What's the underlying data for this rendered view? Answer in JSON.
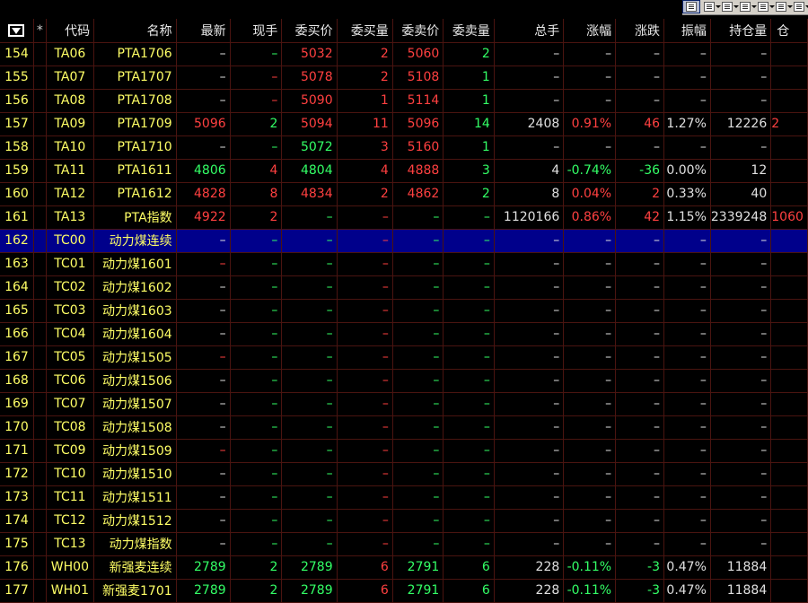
{
  "toolbar": {
    "icons": [
      "draw-tool-icon",
      "pencil-icon",
      "list-icon",
      "column-icon",
      "chart-icon",
      "grid-icon",
      "table-icon"
    ]
  },
  "headers": {
    "star": "*",
    "code": "代码",
    "name": "名称",
    "last": "最新",
    "vol_now": "现手",
    "bid": "委买价",
    "bid_vol": "委买量",
    "ask": "委卖价",
    "ask_vol": "委卖量",
    "total": "总手",
    "chg_pct": "涨幅",
    "chg": "涨跌",
    "amp": "振幅",
    "oi": "持仓量",
    "more": "仓"
  },
  "rows": [
    {
      "idx": "154",
      "code": "TA06",
      "name": "PTA1706",
      "last": "–",
      "vol_now": "–",
      "bid": "5032",
      "bid_vol": "2",
      "ask": "5060",
      "ask_vol": "2",
      "total": "–",
      "chg_pct": "–",
      "chg": "–",
      "amp": "–",
      "oi": "–",
      "more": ""
    },
    {
      "idx": "155",
      "code": "TA07",
      "name": "PTA1707",
      "last": "–",
      "vol_now": "–",
      "bid": "5078",
      "bid_vol": "2",
      "ask": "5108",
      "ask_vol": "1",
      "total": "–",
      "chg_pct": "–",
      "chg": "–",
      "amp": "–",
      "oi": "–",
      "more": ""
    },
    {
      "idx": "156",
      "code": "TA08",
      "name": "PTA1708",
      "last": "–",
      "vol_now": "–",
      "bid": "5090",
      "bid_vol": "1",
      "ask": "5114",
      "ask_vol": "1",
      "total": "–",
      "chg_pct": "–",
      "chg": "–",
      "amp": "–",
      "oi": "–",
      "more": ""
    },
    {
      "idx": "157",
      "code": "TA09",
      "name": "PTA1709",
      "last": "5096",
      "vol_now": "2",
      "bid": "5094",
      "bid_vol": "11",
      "ask": "5096",
      "ask_vol": "14",
      "total": "2408",
      "chg_pct": "0.91%",
      "chg": "46",
      "amp": "1.27%",
      "oi": "12226",
      "more": "2"
    },
    {
      "idx": "158",
      "code": "TA10",
      "name": "PTA1710",
      "last": "–",
      "vol_now": "–",
      "bid": "5072",
      "bid_vol": "3",
      "ask": "5160",
      "ask_vol": "1",
      "total": "–",
      "chg_pct": "–",
      "chg": "–",
      "amp": "–",
      "oi": "–",
      "more": ""
    },
    {
      "idx": "159",
      "code": "TA11",
      "name": "PTA1611",
      "last": "4806",
      "vol_now": "4",
      "bid": "4804",
      "bid_vol": "4",
      "ask": "4888",
      "ask_vol": "3",
      "total": "4",
      "chg_pct": "-0.74%",
      "chg": "-36",
      "amp": "0.00%",
      "oi": "12",
      "more": ""
    },
    {
      "idx": "160",
      "code": "TA12",
      "name": "PTA1612",
      "last": "4828",
      "vol_now": "8",
      "bid": "4834",
      "bid_vol": "2",
      "ask": "4862",
      "ask_vol": "2",
      "total": "8",
      "chg_pct": "0.04%",
      "chg": "2",
      "amp": "0.33%",
      "oi": "40",
      "more": ""
    },
    {
      "idx": "161",
      "code": "TA13",
      "name": "PTA指数",
      "last": "4922",
      "vol_now": "2",
      "bid": "–",
      "bid_vol": "–",
      "ask": "–",
      "ask_vol": "–",
      "total": "1120166",
      "chg_pct": "0.86%",
      "chg": "42",
      "amp": "1.15%",
      "oi": "2339248",
      "more": "1060"
    },
    {
      "idx": "162",
      "code": "TC00",
      "name": "动力煤连续",
      "last": "–",
      "vol_now": "–",
      "bid": "–",
      "bid_vol": "–",
      "ask": "–",
      "ask_vol": "–",
      "total": "–",
      "chg_pct": "–",
      "chg": "–",
      "amp": "–",
      "oi": "–",
      "more": ""
    },
    {
      "idx": "163",
      "code": "TC01",
      "name": "动力煤1601",
      "last": "–",
      "vol_now": "–",
      "bid": "–",
      "bid_vol": "–",
      "ask": "–",
      "ask_vol": "–",
      "total": "–",
      "chg_pct": "–",
      "chg": "–",
      "amp": "–",
      "oi": "–",
      "more": ""
    },
    {
      "idx": "164",
      "code": "TC02",
      "name": "动力煤1602",
      "last": "–",
      "vol_now": "–",
      "bid": "–",
      "bid_vol": "–",
      "ask": "–",
      "ask_vol": "–",
      "total": "–",
      "chg_pct": "–",
      "chg": "–",
      "amp": "–",
      "oi": "–",
      "more": ""
    },
    {
      "idx": "165",
      "code": "TC03",
      "name": "动力煤1603",
      "last": "–",
      "vol_now": "–",
      "bid": "–",
      "bid_vol": "–",
      "ask": "–",
      "ask_vol": "–",
      "total": "–",
      "chg_pct": "–",
      "chg": "–",
      "amp": "–",
      "oi": "–",
      "more": ""
    },
    {
      "idx": "166",
      "code": "TC04",
      "name": "动力煤1604",
      "last": "–",
      "vol_now": "–",
      "bid": "–",
      "bid_vol": "–",
      "ask": "–",
      "ask_vol": "–",
      "total": "–",
      "chg_pct": "–",
      "chg": "–",
      "amp": "–",
      "oi": "–",
      "more": ""
    },
    {
      "idx": "167",
      "code": "TC05",
      "name": "动力煤1505",
      "last": "–",
      "vol_now": "–",
      "bid": "–",
      "bid_vol": "–",
      "ask": "–",
      "ask_vol": "–",
      "total": "–",
      "chg_pct": "–",
      "chg": "–",
      "amp": "–",
      "oi": "–",
      "more": ""
    },
    {
      "idx": "168",
      "code": "TC06",
      "name": "动力煤1506",
      "last": "–",
      "vol_now": "–",
      "bid": "–",
      "bid_vol": "–",
      "ask": "–",
      "ask_vol": "–",
      "total": "–",
      "chg_pct": "–",
      "chg": "–",
      "amp": "–",
      "oi": "–",
      "more": ""
    },
    {
      "idx": "169",
      "code": "TC07",
      "name": "动力煤1507",
      "last": "–",
      "vol_now": "–",
      "bid": "–",
      "bid_vol": "–",
      "ask": "–",
      "ask_vol": "–",
      "total": "–",
      "chg_pct": "–",
      "chg": "–",
      "amp": "–",
      "oi": "–",
      "more": ""
    },
    {
      "idx": "170",
      "code": "TC08",
      "name": "动力煤1508",
      "last": "–",
      "vol_now": "–",
      "bid": "–",
      "bid_vol": "–",
      "ask": "–",
      "ask_vol": "–",
      "total": "–",
      "chg_pct": "–",
      "chg": "–",
      "amp": "–",
      "oi": "–",
      "more": ""
    },
    {
      "idx": "171",
      "code": "TC09",
      "name": "动力煤1509",
      "last": "–",
      "vol_now": "–",
      "bid": "–",
      "bid_vol": "–",
      "ask": "–",
      "ask_vol": "–",
      "total": "–",
      "chg_pct": "–",
      "chg": "–",
      "amp": "–",
      "oi": "–",
      "more": ""
    },
    {
      "idx": "172",
      "code": "TC10",
      "name": "动力煤1510",
      "last": "–",
      "vol_now": "–",
      "bid": "–",
      "bid_vol": "–",
      "ask": "–",
      "ask_vol": "–",
      "total": "–",
      "chg_pct": "–",
      "chg": "–",
      "amp": "–",
      "oi": "–",
      "more": ""
    },
    {
      "idx": "173",
      "code": "TC11",
      "name": "动力煤1511",
      "last": "–",
      "vol_now": "–",
      "bid": "–",
      "bid_vol": "–",
      "ask": "–",
      "ask_vol": "–",
      "total": "–",
      "chg_pct": "–",
      "chg": "–",
      "amp": "–",
      "oi": "–",
      "more": ""
    },
    {
      "idx": "174",
      "code": "TC12",
      "name": "动力煤1512",
      "last": "–",
      "vol_now": "–",
      "bid": "–",
      "bid_vol": "–",
      "ask": "–",
      "ask_vol": "–",
      "total": "–",
      "chg_pct": "–",
      "chg": "–",
      "amp": "–",
      "oi": "–",
      "more": ""
    },
    {
      "idx": "175",
      "code": "TC13",
      "name": "动力煤指数",
      "last": "–",
      "vol_now": "–",
      "bid": "–",
      "bid_vol": "–",
      "ask": "–",
      "ask_vol": "–",
      "total": "–",
      "chg_pct": "–",
      "chg": "–",
      "amp": "–",
      "oi": "–",
      "more": ""
    },
    {
      "idx": "176",
      "code": "WH00",
      "name": "新强麦连续",
      "last": "2789",
      "vol_now": "2",
      "bid": "2789",
      "bid_vol": "6",
      "ask": "2791",
      "ask_vol": "6",
      "total": "228",
      "chg_pct": "-0.11%",
      "chg": "-3",
      "amp": "0.47%",
      "oi": "11884",
      "more": ""
    },
    {
      "idx": "177",
      "code": "WH01",
      "name": "新强麦1701",
      "last": "2789",
      "vol_now": "2",
      "bid": "2789",
      "bid_vol": "6",
      "ask": "2791",
      "ask_vol": "6",
      "total": "228",
      "chg_pct": "-0.11%",
      "chg": "-3",
      "amp": "0.47%",
      "oi": "11884",
      "more": ""
    }
  ],
  "colors": {
    "up": "#ff4040",
    "down": "#33ff66",
    "neutral": "#e0e0e0",
    "label": "#ffff66",
    "selected_row": "#00008b",
    "grid": "#4a1410"
  },
  "row_colors": {
    "154": {
      "last": "w",
      "vol_now": "g",
      "bid": "r",
      "bid_vol": "r",
      "ask": "r",
      "ask_vol": "g",
      "total": "w",
      "chg_pct": "w",
      "chg": "w",
      "amp": "w",
      "oi": "w"
    },
    "155": {
      "last": "w",
      "vol_now": "r",
      "bid": "r",
      "bid_vol": "r",
      "ask": "r",
      "ask_vol": "g",
      "total": "w",
      "chg_pct": "w",
      "chg": "w",
      "amp": "w",
      "oi": "w"
    },
    "156": {
      "last": "w",
      "vol_now": "r",
      "bid": "r",
      "bid_vol": "r",
      "ask": "r",
      "ask_vol": "g",
      "total": "w",
      "chg_pct": "w",
      "chg": "w",
      "amp": "w",
      "oi": "w"
    },
    "157": {
      "last": "r",
      "vol_now": "g",
      "bid": "r",
      "bid_vol": "r",
      "ask": "r",
      "ask_vol": "g",
      "total": "w",
      "chg_pct": "r",
      "chg": "r",
      "amp": "w",
      "oi": "w",
      "more": "r"
    },
    "158": {
      "last": "w",
      "vol_now": "g",
      "bid": "g",
      "bid_vol": "r",
      "ask": "r",
      "ask_vol": "g",
      "total": "w",
      "chg_pct": "w",
      "chg": "w",
      "amp": "w",
      "oi": "w"
    },
    "159": {
      "last": "g",
      "vol_now": "r",
      "bid": "g",
      "bid_vol": "r",
      "ask": "r",
      "ask_vol": "g",
      "total": "w",
      "chg_pct": "g",
      "chg": "g",
      "amp": "w",
      "oi": "w"
    },
    "160": {
      "last": "r",
      "vol_now": "r",
      "bid": "r",
      "bid_vol": "r",
      "ask": "r",
      "ask_vol": "g",
      "total": "w",
      "chg_pct": "r",
      "chg": "r",
      "amp": "w",
      "oi": "w"
    },
    "161": {
      "last": "r",
      "vol_now": "r",
      "bid": "g",
      "bid_vol": "r",
      "ask": "g",
      "ask_vol": "g",
      "total": "w",
      "chg_pct": "r",
      "chg": "r",
      "amp": "w",
      "oi": "w",
      "more": "r"
    },
    "162": {
      "last": "w",
      "vol_now": "g",
      "bid": "g",
      "bid_vol": "r",
      "ask": "g",
      "ask_vol": "g",
      "total": "w",
      "chg_pct": "w",
      "chg": "w",
      "amp": "w",
      "oi": "w"
    },
    "163": {
      "last": "r",
      "vol_now": "g",
      "bid": "g",
      "bid_vol": "r",
      "ask": "g",
      "ask_vol": "g",
      "total": "w",
      "chg_pct": "w",
      "chg": "w",
      "amp": "w",
      "oi": "w"
    },
    "164": {
      "last": "w",
      "vol_now": "g",
      "bid": "g",
      "bid_vol": "r",
      "ask": "g",
      "ask_vol": "g",
      "total": "w",
      "chg_pct": "w",
      "chg": "w",
      "amp": "w",
      "oi": "w"
    },
    "165": {
      "last": "w",
      "vol_now": "g",
      "bid": "g",
      "bid_vol": "r",
      "ask": "g",
      "ask_vol": "g",
      "total": "w",
      "chg_pct": "w",
      "chg": "w",
      "amp": "w",
      "oi": "w"
    },
    "166": {
      "last": "w",
      "vol_now": "g",
      "bid": "g",
      "bid_vol": "r",
      "ask": "g",
      "ask_vol": "g",
      "total": "w",
      "chg_pct": "w",
      "chg": "w",
      "amp": "w",
      "oi": "w"
    },
    "167": {
      "last": "r",
      "vol_now": "g",
      "bid": "g",
      "bid_vol": "r",
      "ask": "g",
      "ask_vol": "g",
      "total": "w",
      "chg_pct": "w",
      "chg": "w",
      "amp": "w",
      "oi": "w"
    },
    "168": {
      "last": "w",
      "vol_now": "g",
      "bid": "g",
      "bid_vol": "r",
      "ask": "g",
      "ask_vol": "g",
      "total": "w",
      "chg_pct": "w",
      "chg": "w",
      "amp": "w",
      "oi": "w"
    },
    "169": {
      "last": "w",
      "vol_now": "g",
      "bid": "g",
      "bid_vol": "r",
      "ask": "g",
      "ask_vol": "g",
      "total": "w",
      "chg_pct": "w",
      "chg": "w",
      "amp": "w",
      "oi": "w"
    },
    "170": {
      "last": "w",
      "vol_now": "g",
      "bid": "g",
      "bid_vol": "r",
      "ask": "g",
      "ask_vol": "g",
      "total": "w",
      "chg_pct": "w",
      "chg": "w",
      "amp": "w",
      "oi": "w"
    },
    "171": {
      "last": "r",
      "vol_now": "g",
      "bid": "g",
      "bid_vol": "r",
      "ask": "g",
      "ask_vol": "g",
      "total": "w",
      "chg_pct": "w",
      "chg": "w",
      "amp": "w",
      "oi": "w"
    },
    "172": {
      "last": "w",
      "vol_now": "g",
      "bid": "g",
      "bid_vol": "r",
      "ask": "g",
      "ask_vol": "g",
      "total": "w",
      "chg_pct": "w",
      "chg": "w",
      "amp": "w",
      "oi": "w"
    },
    "173": {
      "last": "w",
      "vol_now": "g",
      "bid": "g",
      "bid_vol": "r",
      "ask": "g",
      "ask_vol": "g",
      "total": "w",
      "chg_pct": "w",
      "chg": "w",
      "amp": "w",
      "oi": "w"
    },
    "174": {
      "last": "w",
      "vol_now": "g",
      "bid": "g",
      "bid_vol": "r",
      "ask": "g",
      "ask_vol": "g",
      "total": "w",
      "chg_pct": "w",
      "chg": "w",
      "amp": "w",
      "oi": "w"
    },
    "175": {
      "last": "w",
      "vol_now": "g",
      "bid": "g",
      "bid_vol": "r",
      "ask": "g",
      "ask_vol": "g",
      "total": "w",
      "chg_pct": "w",
      "chg": "w",
      "amp": "w",
      "oi": "w"
    },
    "176": {
      "last": "g",
      "vol_now": "g",
      "bid": "g",
      "bid_vol": "r",
      "ask": "g",
      "ask_vol": "g",
      "total": "w",
      "chg_pct": "g",
      "chg": "g",
      "amp": "w",
      "oi": "w"
    },
    "177": {
      "last": "g",
      "vol_now": "g",
      "bid": "g",
      "bid_vol": "r",
      "ask": "g",
      "ask_vol": "g",
      "total": "w",
      "chg_pct": "g",
      "chg": "g",
      "amp": "w",
      "oi": "w"
    }
  },
  "selected_idx": "162"
}
